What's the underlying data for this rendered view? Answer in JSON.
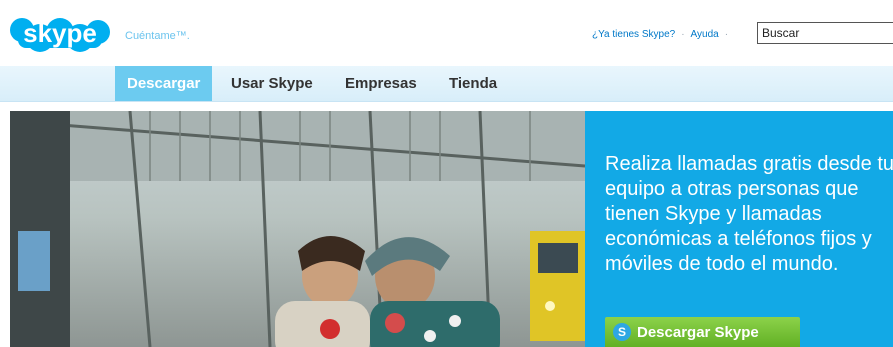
{
  "header": {
    "logo_text": "skype",
    "tagline": "Cuéntame™.",
    "links": [
      "¿Ya tienes Skype?",
      "Ayuda"
    ],
    "search_value": "Buscar"
  },
  "nav": {
    "items": [
      {
        "label": "Descargar",
        "active": true
      },
      {
        "label": "Usar Skype",
        "active": false
      },
      {
        "label": "Empresas",
        "active": false
      },
      {
        "label": "Tienda",
        "active": false
      }
    ]
  },
  "hero": {
    "promo_text": "Realiza llamadas gratis desde tu equipo a otras personas que tienen Skype y llamadas económicas a teléfonos fijos y móviles de todo el mundo.",
    "button_label": "Descargar Skype"
  },
  "colors": {
    "brand_blue": "#00aff0",
    "nav_active": "#6ccbf0",
    "promo_bg": "#12a9e6",
    "button_green": "#6ab92a"
  },
  "icons": {
    "logo": "skype-logo",
    "button_icon": "skype-s-icon"
  }
}
